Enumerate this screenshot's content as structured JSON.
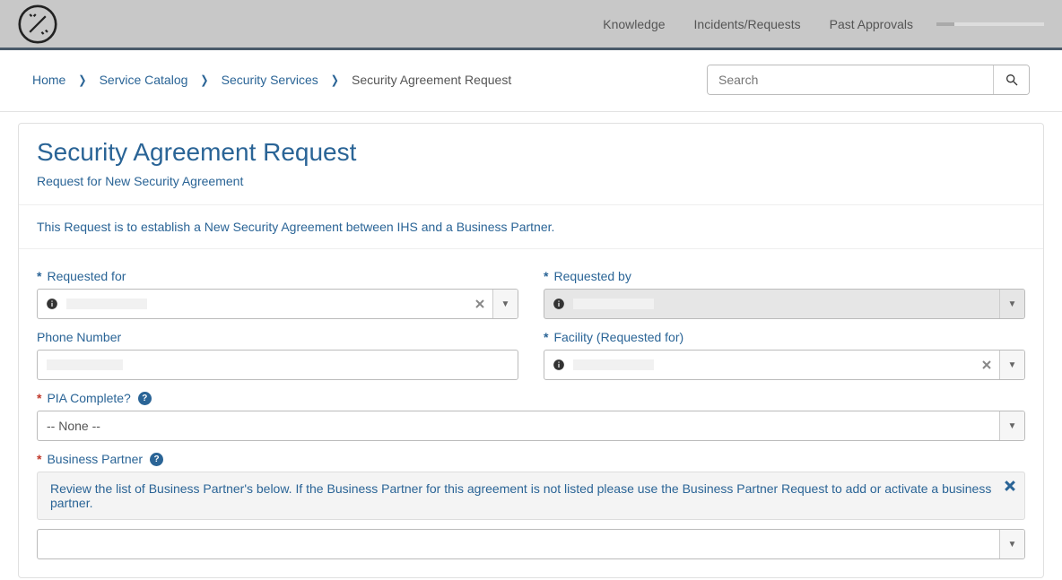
{
  "nav": {
    "knowledge": "Knowledge",
    "incidents": "Incidents/Requests",
    "past_approvals": "Past Approvals"
  },
  "breadcrumb": {
    "home": "Home",
    "service_catalog": "Service Catalog",
    "security_services": "Security Services",
    "current": "Security Agreement Request"
  },
  "search": {
    "placeholder": "Search"
  },
  "page": {
    "title": "Security Agreement Request",
    "subtitle": "Request for New Security Agreement",
    "description": "This Request is to establish a New Security Agreement between IHS and a Business Partner."
  },
  "form": {
    "requested_for": {
      "label": "Requested for",
      "value": ""
    },
    "requested_by": {
      "label": "Requested by",
      "value": ""
    },
    "phone": {
      "label": "Phone Number",
      "value": ""
    },
    "facility": {
      "label": "Facility (Requested for)",
      "value": ""
    },
    "pia": {
      "label": "PIA Complete?",
      "value": "-- None --"
    },
    "business_partner": {
      "label": "Business Partner",
      "info": "Review the list of Business Partner's below. If the Business Partner for this agreement is not listed please use the Business Partner Request to add or activate a business partner.",
      "value": ""
    }
  }
}
